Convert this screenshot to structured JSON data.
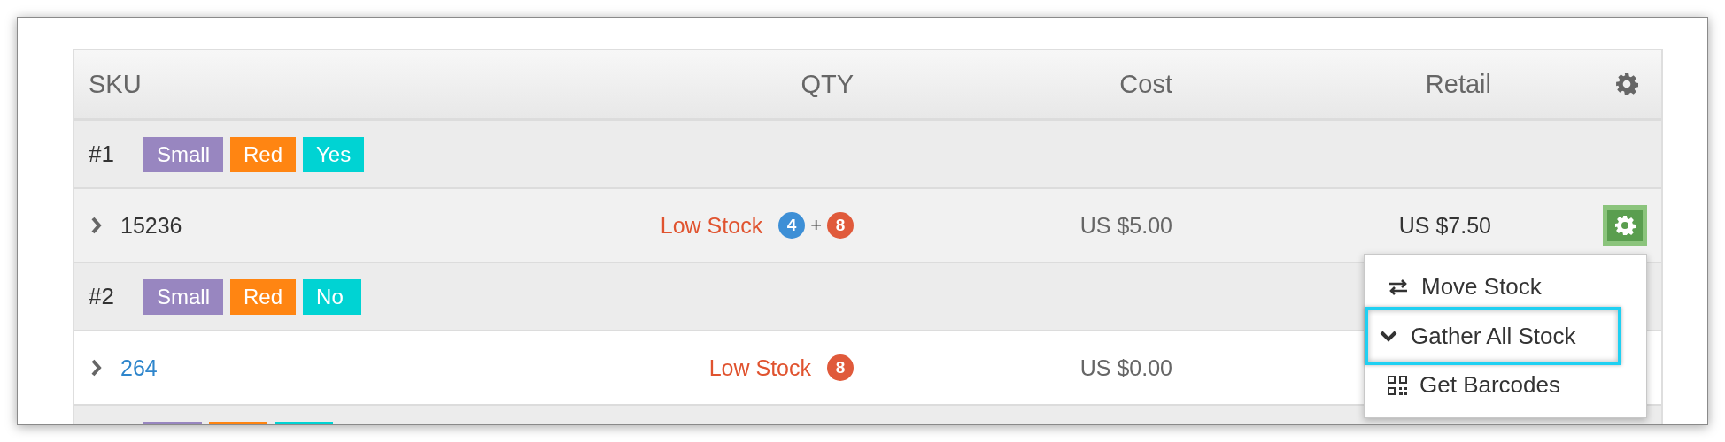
{
  "table": {
    "columns": [
      {
        "label": "SKU"
      },
      {
        "label": "QTY"
      },
      {
        "label": "Cost"
      },
      {
        "label": "Retail"
      }
    ],
    "rows": [
      {
        "kind": "group",
        "label": "#1",
        "tags": [
          {
            "text": "Small",
            "color": "#9886c0"
          },
          {
            "text": "Red",
            "color": "#ff8512"
          },
          {
            "text": "Yes",
            "color": "#00d3d3"
          }
        ]
      },
      {
        "kind": "item",
        "expanded": false,
        "sku": "15236",
        "link": false,
        "hovered": true,
        "status": "Low Stock",
        "qty": [
          {
            "kind": "badge",
            "text": "4",
            "color": "#3d8fd6"
          },
          {
            "kind": "sep",
            "text": "+"
          },
          {
            "kind": "badge",
            "text": "8",
            "color": "#e05a3b"
          }
        ],
        "cost": "US $5.00",
        "retail": "US $7.50",
        "actions": {
          "open": true,
          "menu": [
            {
              "kind": "swap",
              "label": "Move Stock",
              "highlighted": false
            },
            {
              "kind": "chevron",
              "label": "Gather All Stock",
              "highlighted": true
            },
            {
              "kind": "qr",
              "label": "Get Barcodes",
              "highlighted": false
            }
          ]
        }
      },
      {
        "kind": "group",
        "label": "#2",
        "tags": [
          {
            "text": "Small",
            "color": "#9886c0"
          },
          {
            "text": "Red",
            "color": "#ff8512"
          },
          {
            "text": "No",
            "color": "#00d3d3"
          }
        ]
      },
      {
        "kind": "item",
        "expanded": false,
        "sku": "264",
        "link": true,
        "hovered": false,
        "status": "Low Stock",
        "qty": [
          {
            "kind": "badge",
            "text": "8",
            "color": "#e05a3b"
          }
        ],
        "cost": "US $0.00"
      },
      {
        "kind": "group",
        "tags": [
          {
            "color": "#9886c0"
          },
          {
            "color": "#ff8512"
          },
          {
            "color": "#00d3d3"
          }
        ]
      }
    ]
  }
}
